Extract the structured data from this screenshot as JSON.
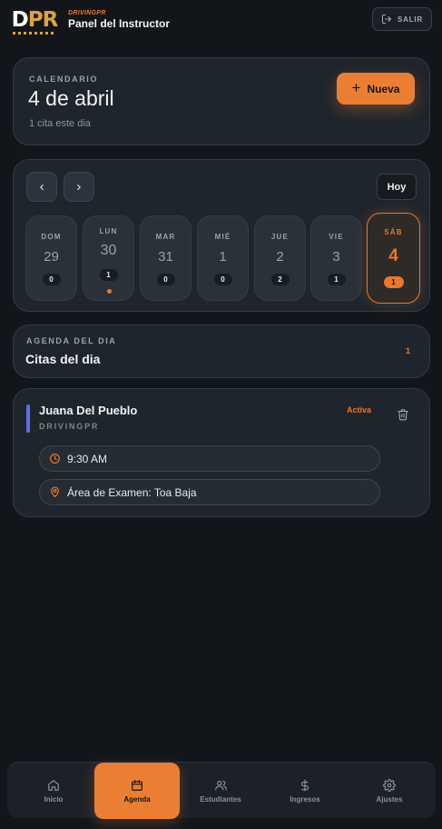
{
  "header": {
    "logo_text_d": "D",
    "logo_text_pr": "PR",
    "brand_small": "DRIVINGPR",
    "brand_title": "Panel del Instructor",
    "logout_label": "SALIR"
  },
  "calendar_card": {
    "eyebrow": "CALENDARIO",
    "date": "4 de abril",
    "subtitle": "1 cita este dia",
    "new_button": "Nueva"
  },
  "week": {
    "today_button": "Hoy",
    "days": [
      {
        "name": "DOM",
        "num": "29",
        "count": "0"
      },
      {
        "name": "LUN",
        "num": "30",
        "count": "1"
      },
      {
        "name": "MAR",
        "num": "31",
        "count": "0"
      },
      {
        "name": "MIÉ",
        "num": "1",
        "count": "0"
      },
      {
        "name": "JUE",
        "num": "2",
        "count": "2"
      },
      {
        "name": "VIE",
        "num": "3",
        "count": "1"
      },
      {
        "name": "SÁB",
        "num": "4",
        "count": "1"
      }
    ]
  },
  "agenda": {
    "eyebrow": "AGENDA DEL DIA",
    "title": "Citas del dia",
    "count": "1"
  },
  "appointment": {
    "name": "Juana Del Pueblo",
    "school": "DRIVINGPR",
    "status": "Activa",
    "time": "9:30 AM",
    "location": "Área de Examen: Toa Baja",
    "accent_color": "#5b6ee8"
  },
  "bottom_nav": [
    {
      "label": "Inicio",
      "icon": "home-icon"
    },
    {
      "label": "Agenda",
      "icon": "calendar-icon"
    },
    {
      "label": "Estudiantes",
      "icon": "users-icon"
    },
    {
      "label": "Ingresos",
      "icon": "dollar-icon"
    },
    {
      "label": "Ajustes",
      "icon": "gear-icon"
    }
  ],
  "colors": {
    "accent": "#ea7f33",
    "background": "#12161b",
    "card": "#1f252c"
  }
}
